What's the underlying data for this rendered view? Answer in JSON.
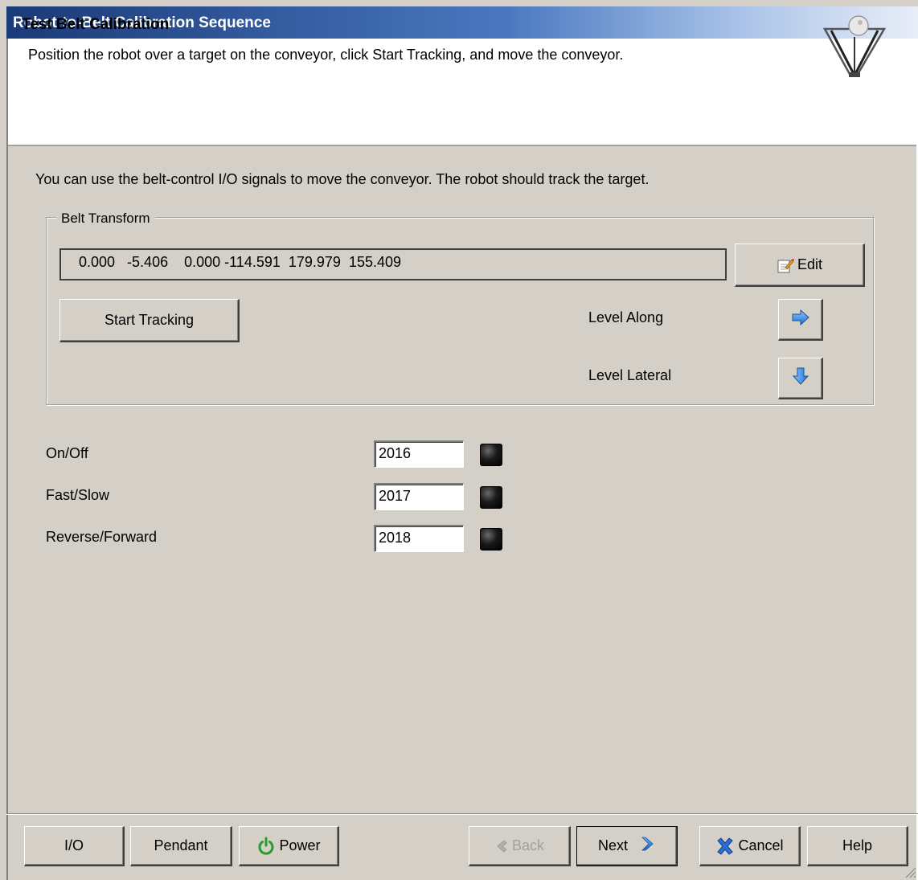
{
  "window": {
    "title": "Robot-to-Belt Calibration Sequence"
  },
  "header": {
    "title": "Test Belt Calibration",
    "description": "Position the robot over a target on the conveyor, click Start Tracking, and move the conveyor.",
    "logo_icon": "delta-robot-icon"
  },
  "intro_text": "You can use the belt-control I/O signals to move the conveyor.  The robot should track the target.",
  "belt_transform": {
    "legend": "Belt Transform",
    "value": "0.000   -5.406    0.000 -114.591  179.979  155.409",
    "edit_label": "Edit",
    "start_tracking_label": "Start Tracking",
    "level_along_label": "Level Along",
    "level_lateral_label": "Level Lateral"
  },
  "io_signals": [
    {
      "label": "On/Off",
      "value": "2016",
      "state": "off"
    },
    {
      "label": "Fast/Slow",
      "value": "2017",
      "state": "off"
    },
    {
      "label": "Reverse/Forward",
      "value": "2018",
      "state": "off"
    }
  ],
  "footer": {
    "io_label": "I/O",
    "pendant_label": "Pendant",
    "power_label": "Power",
    "back_label": "Back",
    "next_label": "Next",
    "cancel_label": "Cancel",
    "help_label": "Help"
  },
  "colors": {
    "accent_blue": "#1f6fd0",
    "power_green": "#2a9a2a",
    "cancel_blue": "#2a6fd6"
  }
}
